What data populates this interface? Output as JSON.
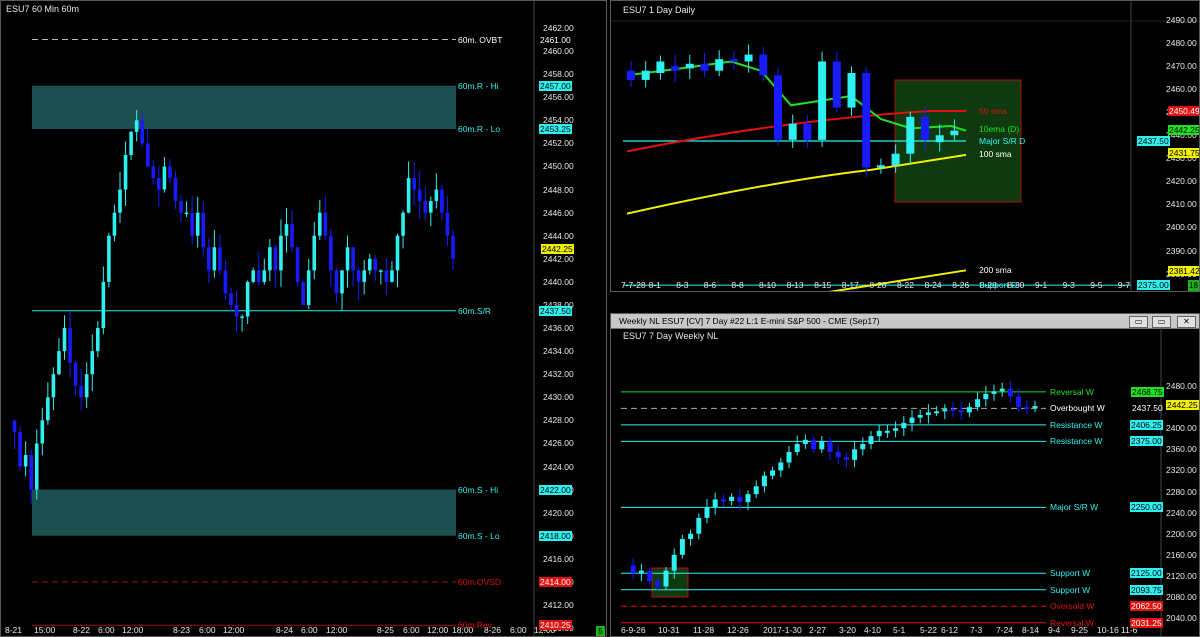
{
  "colors": {
    "cyan": "#2ff0f0",
    "blue": "#1a1aff",
    "red": "#e01010",
    "yellow": "#f0f000",
    "green": "#21e021",
    "zone": "#1c5050",
    "darkgreen": "#0f3a0f"
  },
  "left": {
    "title": "ESU7 60 Min  60m",
    "yticks": [
      "2462.00",
      "2460.00",
      "2458.00",
      "2456.00",
      "2454.00",
      "2452.00",
      "2450.00",
      "2448.00",
      "2446.00",
      "2444.00",
      "2442.00",
      "2440.00",
      "2438.00",
      "2436.00",
      "2434.00",
      "2432.00",
      "2430.00",
      "2428.00",
      "2426.00",
      "2424.00",
      "2422.00",
      "2420.00",
      "2418.00",
      "2416.00",
      "2414.00",
      "2412.00",
      "2410.00"
    ],
    "xticks": [
      "8-21",
      "15:00",
      "8-22",
      "6:00",
      "12:00",
      "8-23",
      "6:00",
      "12:00",
      "8-24",
      "6:00",
      "12:00",
      "8-25",
      "6:00",
      "12:00",
      "18:00",
      "8-26",
      "6:00",
      "12:00"
    ],
    "levels": [
      {
        "label": "60m. OVBT",
        "value": "2461.00",
        "kind": "dash"
      },
      {
        "label": "60m.R - Hi",
        "value": "2457.00",
        "kind": "zone"
      },
      {
        "label": "60m.R - Lo",
        "value": "2453.25",
        "kind": "zone"
      },
      {
        "label": "60m.S/R",
        "value": "2437.50",
        "kind": "line"
      },
      {
        "label": "60m.S - Hi",
        "value": "2422.00",
        "kind": "zone"
      },
      {
        "label": "60m.S - Lo",
        "value": "2418.00",
        "kind": "zone"
      },
      {
        "label": "60m.OVSD",
        "value": "2414.00",
        "kind": "red"
      },
      {
        "label": "60m.Rev",
        "value": "2410.25",
        "kind": "red"
      }
    ],
    "price": "2442.25",
    "corner": "5"
  },
  "daily": {
    "title": "ESU7 1 Day  Daily",
    "yticks": [
      "2490.00",
      "2480.00",
      "2470.00",
      "2460.00",
      "2450.00",
      "2440.00",
      "2430.00",
      "2420.00",
      "2410.00",
      "2400.00",
      "2390.00",
      "2380.00",
      "2370.00"
    ],
    "xticks": [
      "7-7-28",
      "8-1",
      "8-3",
      "8-6",
      "8-8",
      "8-10",
      "8-13",
      "8-15",
      "8-17",
      "8-20",
      "8-22",
      "8-24",
      "8-26",
      "8-28",
      "8-30",
      "9-1",
      "9-3",
      "9-5",
      "9-7"
    ],
    "labels": {
      "sma50": "50 sma",
      "ema10": "10ema (D)",
      "majorsr": "Major S/R D",
      "sma100": "100 sma",
      "sma200": "200 sma",
      "support": "Support D"
    },
    "badges": {
      "sma50": "2450.49",
      "ema10": "2442.25",
      "majorsr": "2437.50",
      "sma100": "2431.75",
      "sma200": "2381.42",
      "support": "2375.00"
    },
    "corner": "18"
  },
  "weekly": {
    "window_title": "Weekly NL  ESU7 [CV] 7 Day  #22  L:1  E-mini S&P 500 - CME (Sep17)",
    "title": "ESU7 7 Day  Weekly NL",
    "yticks": [
      "2480.00",
      "2440.00",
      "2400.00",
      "2360.00",
      "2320.00",
      "2280.00",
      "2240.00",
      "2200.00",
      "2160.00",
      "2120.00",
      "2080.00",
      "2040.00"
    ],
    "xticks": [
      "6-9-26",
      "10-31",
      "11-28",
      "12-26",
      "2017-1-30",
      "2-27",
      "3-20",
      "4-10",
      "5-1",
      "5-22",
      "6-12",
      "7-3",
      "7-24",
      "8-14",
      "9-4",
      "9-25",
      "10-16",
      "11-6"
    ],
    "levels": [
      {
        "label": "Reversal W",
        "value": "2468.75",
        "color": "#21e021"
      },
      {
        "label": "Overbought W",
        "value": "2437.50",
        "color": "#ffffff"
      },
      {
        "label": "Resistance W",
        "value": "2406.25",
        "color": "#2ff0f0"
      },
      {
        "label": "Resistance W",
        "value": "2375.00",
        "color": "#2ff0f0"
      },
      {
        "label": "Major S/R W",
        "value": "2250.00",
        "color": "#2ff0f0"
      },
      {
        "label": "Support W",
        "value": "2125.00",
        "color": "#2ff0f0"
      },
      {
        "label": "Support W",
        "value": "2093.75",
        "color": "#2ff0f0"
      },
      {
        "label": "Oversold W",
        "value": "2062.50",
        "color": "#e01010"
      },
      {
        "label": "Reversal W",
        "value": "2031.25",
        "color": "#e01010"
      }
    ],
    "price": "2442.25",
    "buttons": [
      "▭",
      "▭",
      "✕"
    ]
  }
}
